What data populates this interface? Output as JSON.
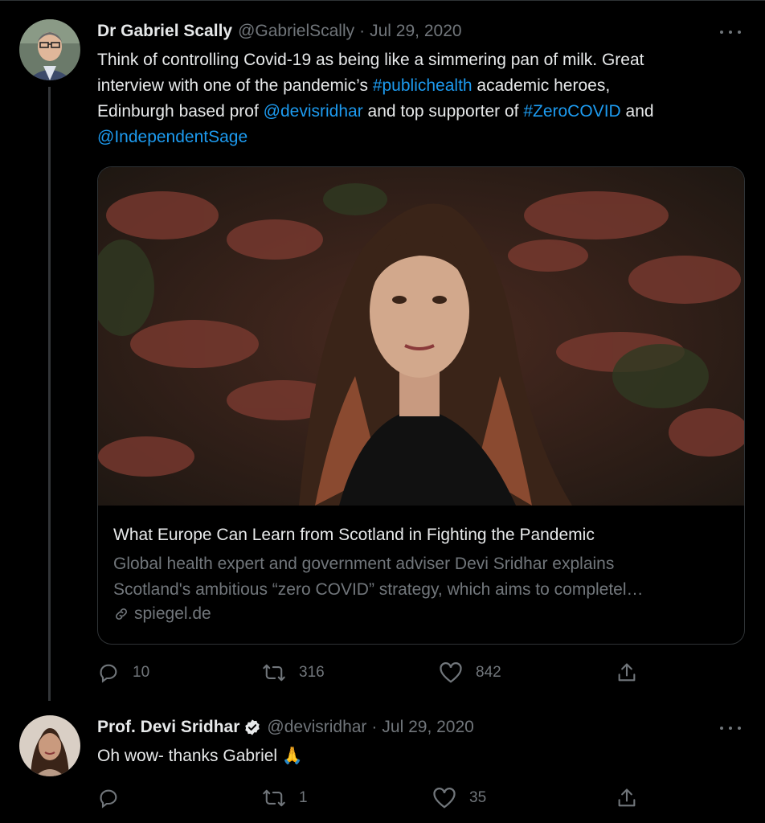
{
  "tweets": [
    {
      "name": "Dr Gabriel Scally",
      "handle": "@GabrielScally",
      "separator": "·",
      "date": "Jul 29, 2020",
      "text_lines": [
        [
          {
            "t": "Think of controlling Covid-19 as being like a simmering pan of milk. Great",
            "link": false
          }
        ],
        [
          {
            "t": "interview with one of the pandemic’s ",
            "link": false
          },
          {
            "t": "#publichealth",
            "link": true
          },
          {
            "t": " academic heroes,",
            "link": false
          }
        ],
        [
          {
            "t": "Edinburgh based prof ",
            "link": false
          },
          {
            "t": "@devisridhar",
            "link": true
          },
          {
            "t": " and top supporter of ",
            "link": false
          },
          {
            "t": "#ZeroCOVID",
            "link": true
          },
          {
            "t": " and",
            "link": false
          }
        ],
        [
          {
            "t": "@IndependentSage",
            "link": true
          }
        ]
      ],
      "card": {
        "title": "What Europe Can Learn from Scotland in Fighting the Pandemic",
        "description_line1": "Global health expert and government adviser Devi Sridhar explains",
        "description_line2": "Scotland's ambitious “zero COVID” strategy, which aims to completel…",
        "domain": "spiegel.de"
      },
      "actions": {
        "replies": "10",
        "retweets": "316",
        "likes": "842"
      }
    },
    {
      "name": "Prof. Devi Sridhar",
      "handle": "@devisridhar",
      "separator": "·",
      "date": "Jul 29, 2020",
      "text": "Oh wow- thanks Gabriel 🙏",
      "actions": {
        "replies": "",
        "retweets": "1",
        "likes": "35"
      }
    }
  ],
  "colors": {
    "background": "#000000",
    "text": "#e7e9ea",
    "muted": "#71767b",
    "link": "#1d9bf0",
    "border": "#2f3336"
  },
  "icons": [
    "more-icon",
    "reply-icon",
    "retweet-icon",
    "like-icon",
    "share-icon",
    "verified-badge-icon",
    "link-icon"
  ]
}
